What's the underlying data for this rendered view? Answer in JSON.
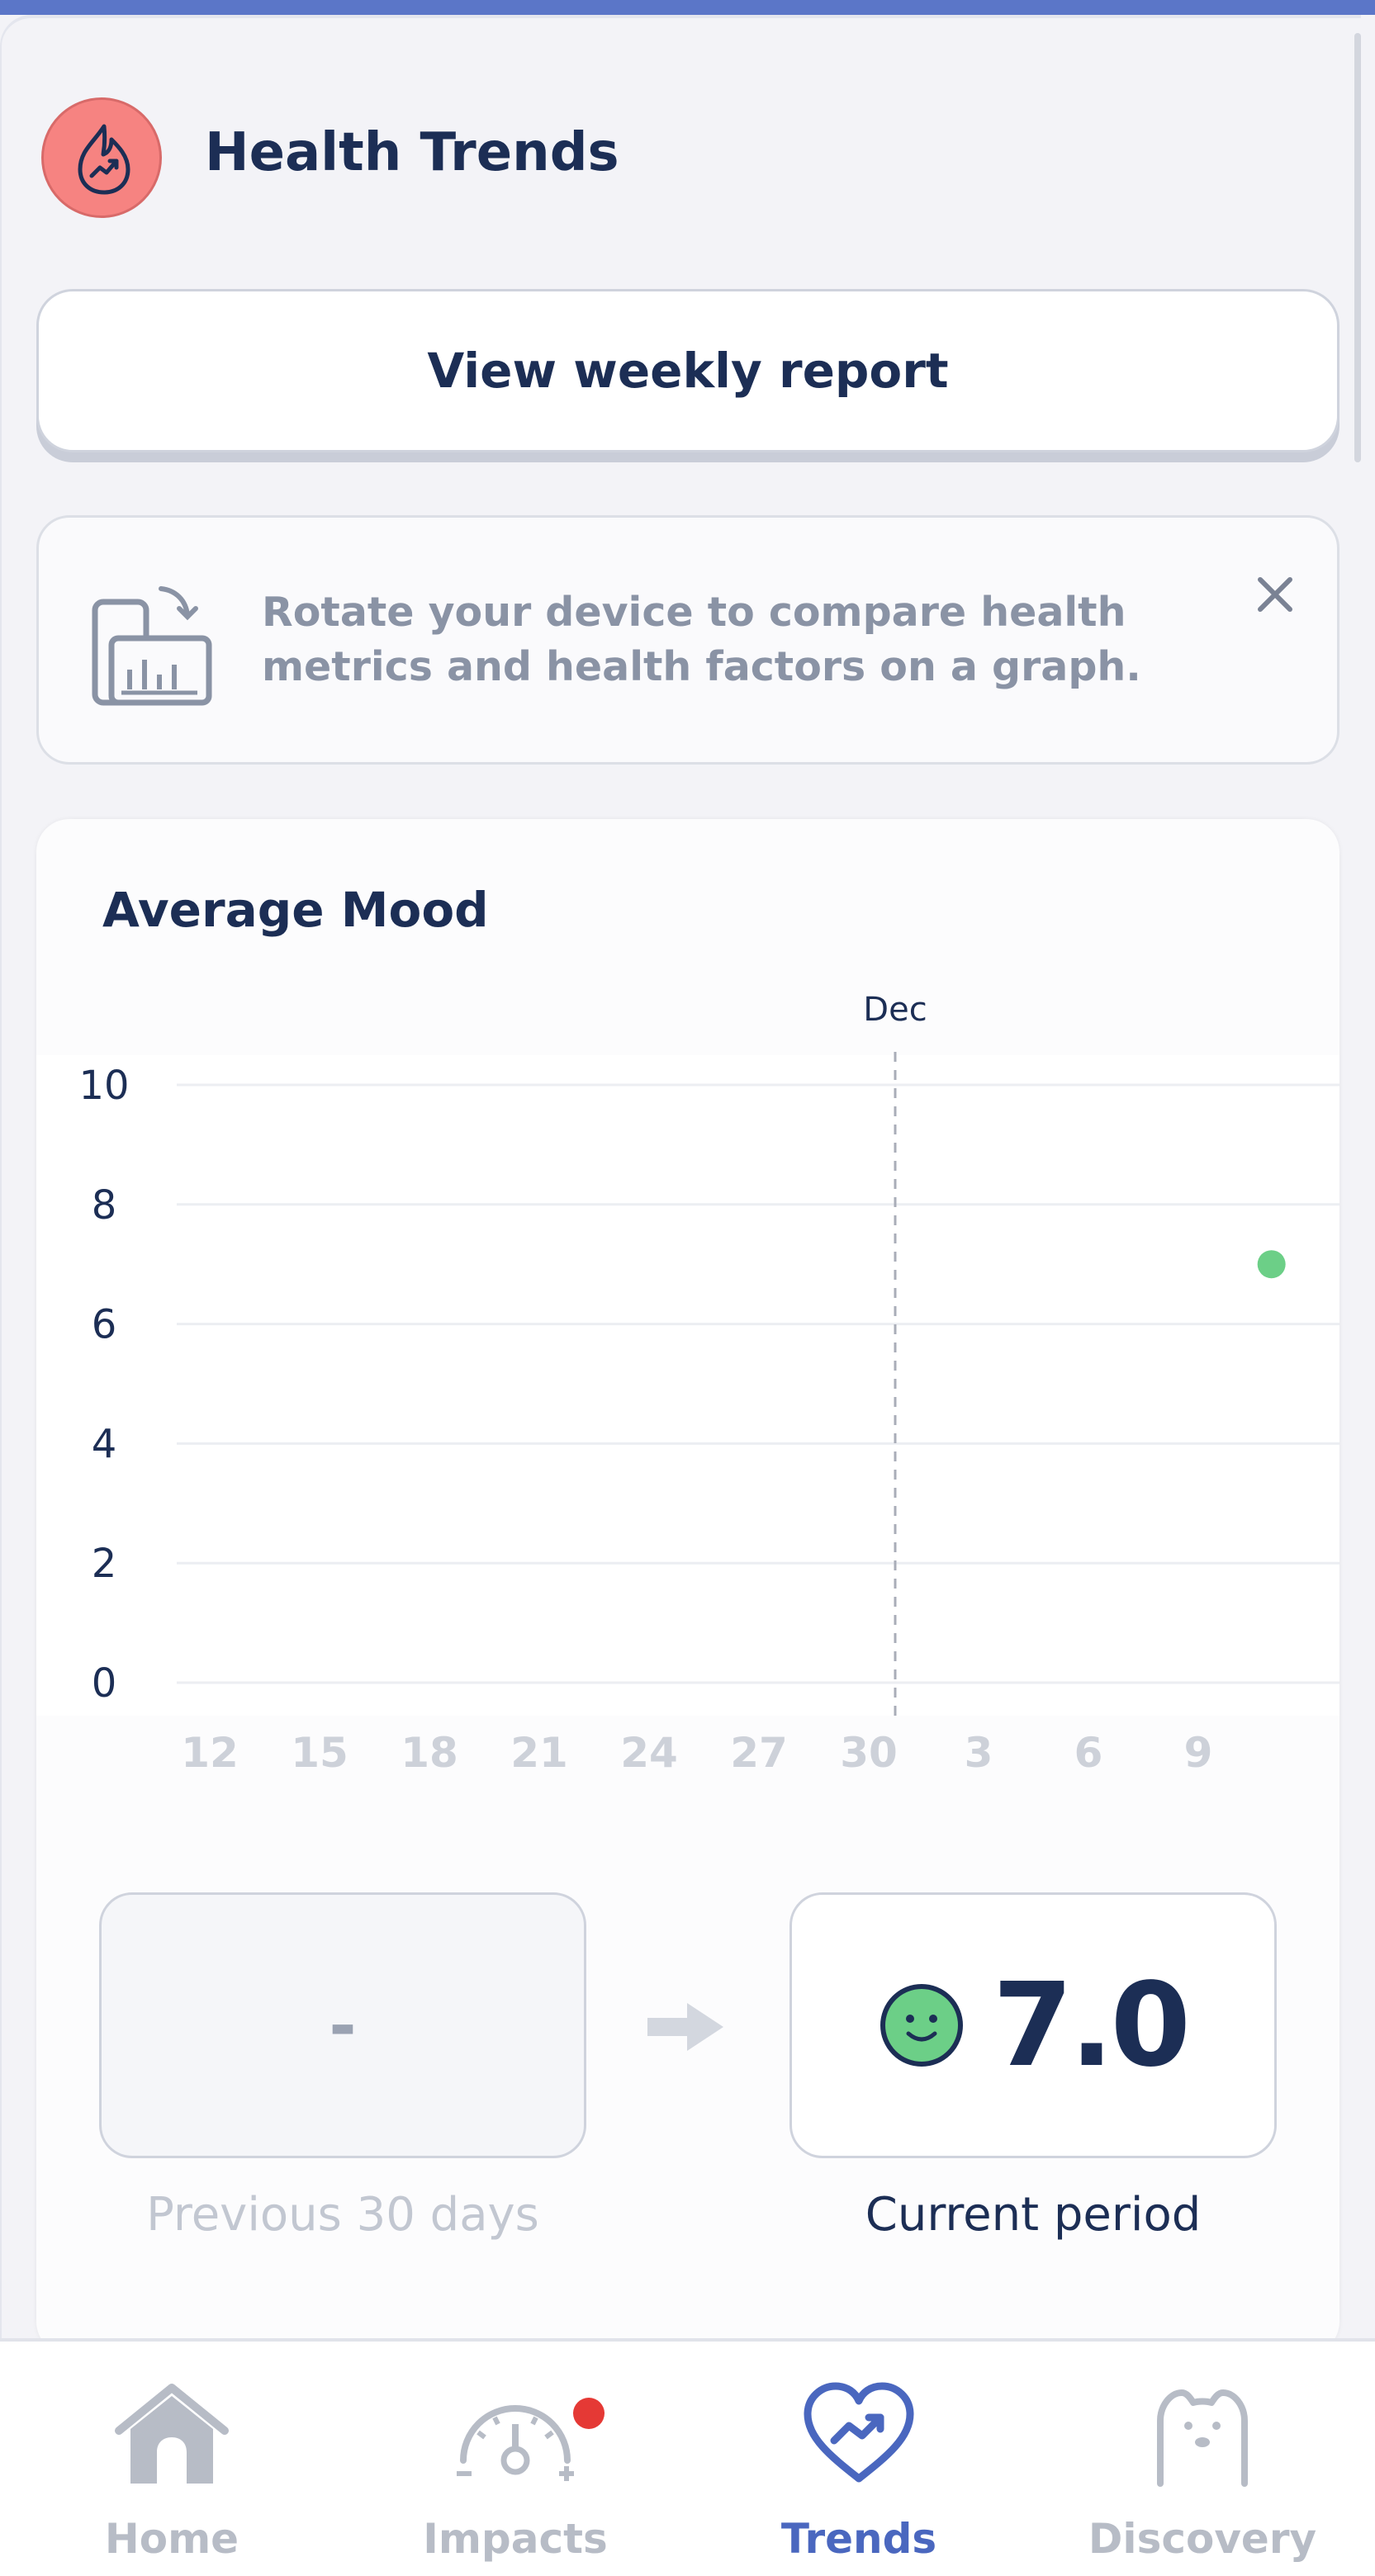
{
  "header": {
    "title": "Health Trends"
  },
  "weekly_report": {
    "label": "View weekly report"
  },
  "tip": {
    "text": "Rotate your device to compare health metrics and health factors on a graph."
  },
  "mood": {
    "title": "Average Mood",
    "previous": {
      "value": "-",
      "label": "Previous 30 days"
    },
    "current": {
      "value": "7.0",
      "label": "Current period"
    }
  },
  "chart_data": {
    "type": "scatter",
    "title": "Average Mood",
    "month_marker": {
      "label": "Dec",
      "at_tick": "30"
    },
    "y_ticks": [
      "10",
      "8",
      "6",
      "4",
      "2",
      "0"
    ],
    "ylim": [
      0,
      10
    ],
    "x_ticks": [
      "12",
      "15",
      "18",
      "21",
      "24",
      "27",
      "30",
      "3",
      "6",
      "9"
    ],
    "points": [
      {
        "x": "11 Dec",
        "y": 7.0,
        "color": "#6ccf87"
      }
    ],
    "grid": true
  },
  "tabs": [
    {
      "label": "Home",
      "icon": "house-icon",
      "active": false
    },
    {
      "label": "Impacts",
      "icon": "gauge-icon",
      "active": false,
      "badge": true
    },
    {
      "label": "Trends",
      "icon": "heart-trend-icon",
      "active": true
    },
    {
      "label": "Discovery",
      "icon": "bear-icon",
      "active": false
    }
  ],
  "colors": {
    "accent": "#4a67bf",
    "navy": "#1c2e55",
    "mood_good": "#6ccf87",
    "header_icon": "#f68381",
    "badge": "#e53935"
  }
}
